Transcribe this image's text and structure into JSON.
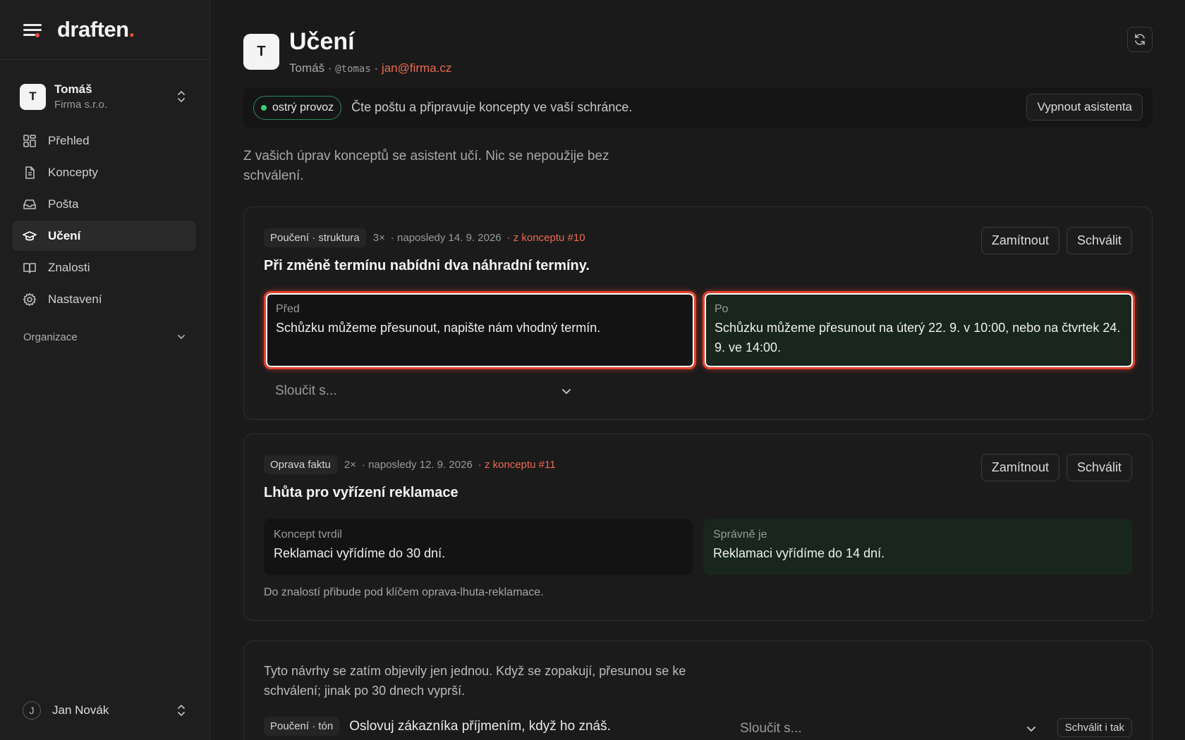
{
  "brand": {
    "name": "draften",
    "accent": "."
  },
  "account": {
    "initial": "T",
    "name": "Tomáš",
    "org": "Firma s.r.o."
  },
  "nav": [
    {
      "label": "Přehled",
      "icon": "dashboard-icon"
    },
    {
      "label": "Koncepty",
      "icon": "document-icon"
    },
    {
      "label": "Pošta",
      "icon": "inbox-icon"
    },
    {
      "label": "Učení",
      "icon": "graduation-cap-icon",
      "active": true
    },
    {
      "label": "Znalosti",
      "icon": "book-icon"
    },
    {
      "label": "Nastavení",
      "icon": "gear-icon"
    }
  ],
  "org_section": "Organizace",
  "user": {
    "initial": "J",
    "name": "Jan Novák"
  },
  "header": {
    "initial": "T",
    "title": "Učení",
    "name": "Tomáš",
    "sep1": "·",
    "handle": "@tomas",
    "sep2": "·",
    "email": "jan@firma.cz"
  },
  "status": {
    "badge": "ostrý provoz",
    "text": "Čte poštu a připravuje koncepty ve vaší schránce.",
    "off_button": "Vypnout asistenta"
  },
  "intro": "Z vašich úprav konceptů se asistent učí. Nic se nepoužije bez schválení.",
  "cards": [
    {
      "tag": "Poučení · struktura",
      "count": "3×",
      "last": "· naposledy 14. 9. 2026",
      "source": "· z konceptu #10",
      "reject": "Zamítnout",
      "approve": "Schválit",
      "title": "Při změně termínu nabídni dva náhradní termíny.",
      "before_label": "Před",
      "before_text": "Schůzku můžeme přesunout, napište nám vhodný termín.",
      "after_label": "Po",
      "after_text": "Schůzku můžeme přesunout na úterý 22. 9. v 10:00, nebo na čtvrtek 24. 9. ve 14:00.",
      "merge_placeholder": "Sloučit s..."
    },
    {
      "tag": "Oprava faktu",
      "count": "2×",
      "last": "· naposledy 12. 9. 2026",
      "source": "· z konceptu #11",
      "reject": "Zamítnout",
      "approve": "Schválit",
      "title": "Lhůta pro vyřízení reklamace",
      "before_label": "Koncept tvrdil",
      "before_text": "Reklamaci vyřídíme do 30 dní.",
      "after_label": "Správně je",
      "after_text": "Reklamaci vyřídíme do 14 dní.",
      "note": "Do znalostí přibude pod klíčem oprava-lhuta-reklamace."
    }
  ],
  "pending": {
    "text": "Tyto návrhy se zatím objevily jen jednou. Když se zopakují, přesunou se ke schválení; jinak po 30 dnech vyprší.",
    "tag": "Poučení · tón",
    "item": "Oslovuj zákazníka příjmením, když ho znáš.",
    "merge_placeholder": "Sloučit s...",
    "approve_anyway": "Schválit i tak"
  },
  "colors": {
    "accent": "#e5533d",
    "live": "#3ccf7a",
    "highlight": "#e2412f"
  }
}
